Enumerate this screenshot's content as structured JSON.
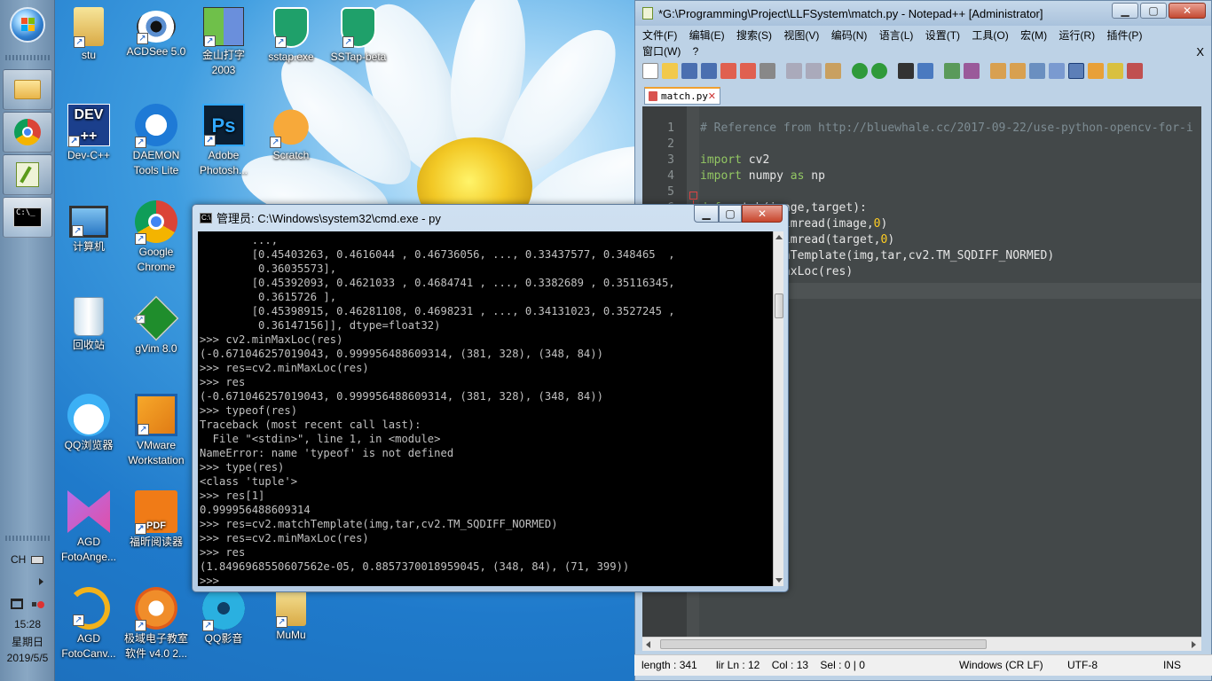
{
  "taskbar": {
    "clock_time": "15:28",
    "clock_day": "星期日",
    "clock_date": "2019/5/5",
    "lang": "CH"
  },
  "desktop_icons": [
    {
      "label": "stu"
    },
    {
      "label": "ACDSee 5.0"
    },
    {
      "label": "金山打字\n2003"
    },
    {
      "label": "sstap.exe"
    },
    {
      "label": "SSTap-beta"
    },
    {
      "label": "Dev-C++"
    },
    {
      "label": "DAEMON\nTools Lite"
    },
    {
      "label": "Adobe\nPhotosh..."
    },
    {
      "label": "Scratch"
    },
    {
      "label": "计算机"
    },
    {
      "label": "Google\nChrome"
    },
    {
      "label": "回收站"
    },
    {
      "label": "gVim 8.0"
    },
    {
      "label": "QQ浏览器"
    },
    {
      "label": "VMware\nWorkstation"
    },
    {
      "label": "AGD\nFotoAnge..."
    },
    {
      "label": "福昕阅读器"
    },
    {
      "label": "AGD\nFotoCanv..."
    },
    {
      "label": "极域电子教室\n软件 v4.0 2..."
    },
    {
      "label": "QQ影音"
    },
    {
      "label": "MuMu"
    }
  ],
  "notepad": {
    "title": "*G:\\Programming\\Project\\LLFSystem\\match.py - Notepad++ [Administrator]",
    "menu": [
      "文件(F)",
      "编辑(E)",
      "搜索(S)",
      "视图(V)",
      "编码(N)",
      "语言(L)",
      "设置(T)",
      "工具(O)",
      "宏(M)",
      "运行(R)",
      "插件(P)",
      "窗口(W)",
      "?"
    ],
    "close_x": "X",
    "tab_label": "match.py",
    "code": [
      {
        "n": "1",
        "text": "# Reference from http://bluewhale.cc/2017-09-22/use-python-opencv-for-i"
      },
      {
        "n": "2",
        "text": ""
      },
      {
        "n": "3",
        "text": "import cv2"
      },
      {
        "n": "4",
        "text": "import numpy as np"
      },
      {
        "n": "5",
        "text": ""
      },
      {
        "n": "6",
        "text": "def match(image,target):"
      },
      {
        "n": "7",
        "text": "    img=cv2.imread(image,0)"
      },
      {
        "n": "8",
        "text": "    tar=cv2.imread(target,0)"
      },
      {
        "n": "9",
        "text": "    cv2.matchTemplate(img,tar,cv2.TM_SQDIFF_NORMED)"
      },
      {
        "n": "10",
        "text": "    cv2.minMaxLoc(res)"
      },
      {
        "n": "11",
        "text": ""
      },
      {
        "n": "12",
        "text": ""
      }
    ],
    "status": {
      "length": "length : 341",
      "ln_col": "lir Ln : 12    Col : 13    Sel : 0 | 0",
      "eol": "Windows (CR LF)",
      "encoding": "UTF-8",
      "mode": "INS"
    }
  },
  "cmd": {
    "title": "管理员: C:\\Windows\\system32\\cmd.exe - py",
    "lines": [
      "        ...,",
      "        [0.45403263, 0.4616044 , 0.46736056, ..., 0.33437577, 0.348465  ,",
      "         0.36035573],",
      "        [0.45392093, 0.4621033 , 0.4684741 , ..., 0.3382689 , 0.35116345,",
      "         0.3615726 ],",
      "        [0.45398915, 0.46281108, 0.4698231 , ..., 0.34131023, 0.3527245 ,",
      "         0.36147156]], dtype=float32)",
      ">>> cv2.minMaxLoc(res)",
      "(-0.671046257019043, 0.999956488609314, (381, 328), (348, 84))",
      ">>> res=cv2.minMaxLoc(res)",
      ">>> res",
      "(-0.671046257019043, 0.999956488609314, (381, 328), (348, 84))",
      ">>> typeof(res)",
      "Traceback (most recent call last):",
      "  File \"<stdin>\", line 1, in <module>",
      "NameError: name 'typeof' is not defined",
      ">>> type(res)",
      "<class 'tuple'>",
      ">>> res[1]",
      "0.999956488609314",
      ">>> res=cv2.matchTemplate(img,tar,cv2.TM_SQDIFF_NORMED)",
      ">>> res=cv2.minMaxLoc(res)",
      ">>> res",
      "(1.8496968550607562e-05, 0.8857370018959045, (348, 84), (71, 399))",
      ">>>"
    ]
  }
}
